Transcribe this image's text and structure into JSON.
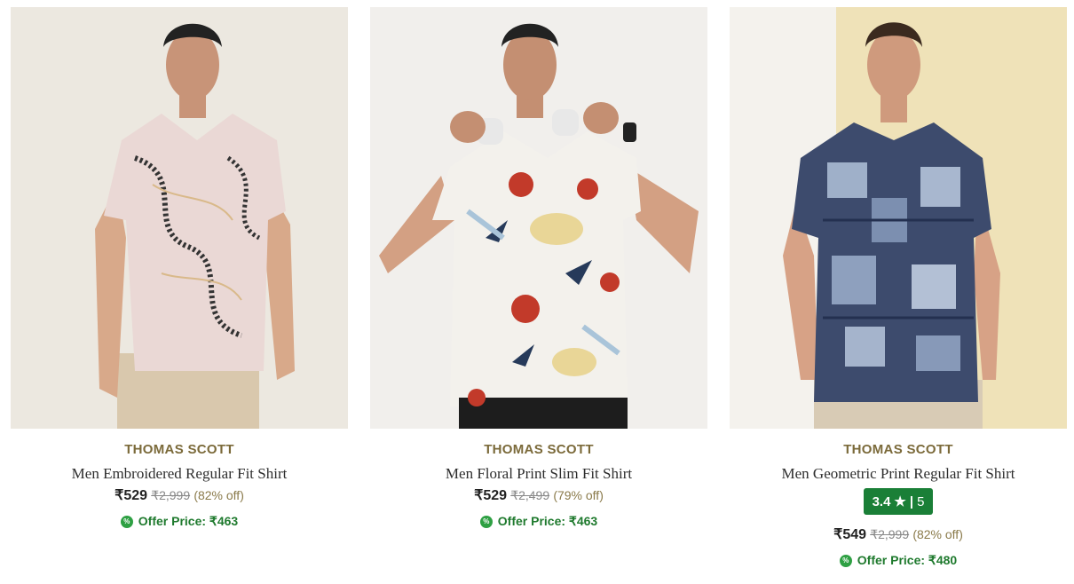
{
  "products": [
    {
      "brand": "THOMAS SCOTT",
      "title": "Men Embroidered Regular Fit Shirt",
      "price": "₹529",
      "mrp": "₹2,999",
      "discount": "(82% off)",
      "offer": "Offer Price: ₹463",
      "bg": "#e9e6df",
      "shirt": "#ead8d5"
    },
    {
      "brand": "THOMAS SCOTT",
      "title": "Men Floral Print Slim Fit Shirt",
      "price": "₹529",
      "mrp": "₹2,499",
      "discount": "(79% off)",
      "offer": "Offer Price: ₹463",
      "bg": "#f1efec",
      "shirt": "#f3f1ec"
    },
    {
      "brand": "THOMAS SCOTT",
      "title": "Men Geometric Print Regular Fit Shirt",
      "rating": "3.4",
      "rating_star": "★",
      "rating_sep": "|",
      "rating_count": "5",
      "price": "₹549",
      "mrp": "₹2,999",
      "discount": "(82% off)",
      "offer": "Offer Price: ₹480",
      "bg": "#efe7d3",
      "shirt": "#3d4b6d"
    }
  ],
  "offer_icon": "percent-icon",
  "colors": {
    "rating_bg": "#1a7f37",
    "offer_text": "#1f7a2e",
    "brand_text": "#7b6a3a"
  }
}
